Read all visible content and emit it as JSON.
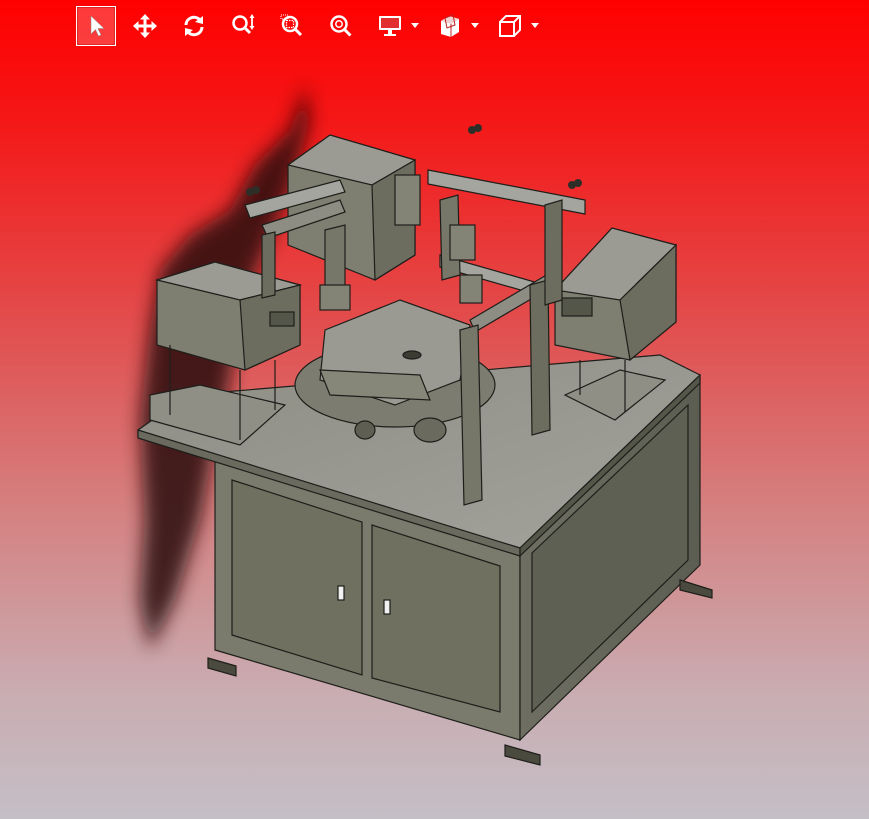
{
  "app": {
    "view": "3d-model-viewport",
    "background_top": "#ff0000",
    "background_bottom": "#c4bfc6"
  },
  "toolbar": {
    "buttons": [
      {
        "id": "select",
        "icon": "cursor-arrow-icon",
        "active": true
      },
      {
        "id": "pan",
        "icon": "move-arrows-icon",
        "active": false
      },
      {
        "id": "rotate",
        "icon": "rotate-icon",
        "active": false
      },
      {
        "id": "zoom",
        "icon": "zoom-vertical-icon",
        "active": false
      },
      {
        "id": "zoom-box",
        "icon": "zoom-window-icon",
        "active": false
      },
      {
        "id": "zoom-fit",
        "icon": "zoom-fit-icon",
        "active": false
      },
      {
        "id": "display",
        "icon": "monitor-icon",
        "active": false,
        "dropdown": true
      },
      {
        "id": "section",
        "icon": "section-cube-icon",
        "active": false,
        "dropdown": true
      },
      {
        "id": "view-orientation",
        "icon": "wire-cube-icon",
        "active": false,
        "dropdown": true
      }
    ]
  },
  "model": {
    "description_icon": "machine-model-icon",
    "body_color": "#8a8a7c",
    "panel_color": "#6f705f",
    "dark_color": "#4a4b3e"
  }
}
